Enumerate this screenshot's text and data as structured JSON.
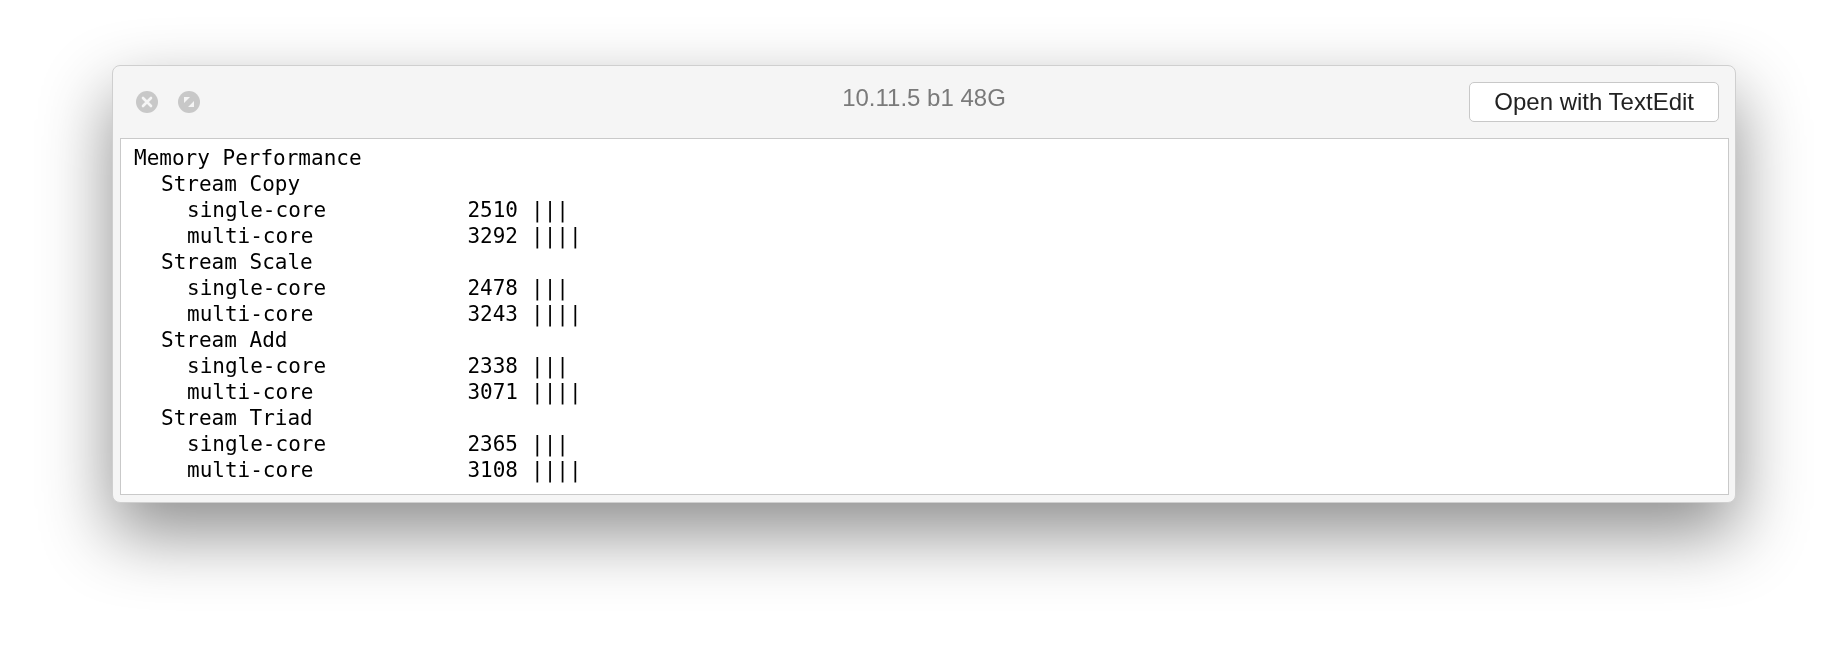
{
  "window": {
    "title": "10.11.5 b1 48G",
    "button": "Open with TextEdit"
  },
  "report": {
    "heading": "Memory Performance",
    "sections": [
      {
        "name": "Stream Copy",
        "rows": [
          {
            "label": "single-core",
            "value": "2510",
            "bars": "|||"
          },
          {
            "label": "multi-core",
            "value": "3292",
            "bars": "||||"
          }
        ]
      },
      {
        "name": "Stream Scale",
        "rows": [
          {
            "label": "single-core",
            "value": "2478",
            "bars": "|||"
          },
          {
            "label": "multi-core",
            "value": "3243",
            "bars": "||||"
          }
        ]
      },
      {
        "name": "Stream Add",
        "rows": [
          {
            "label": "single-core",
            "value": "2338",
            "bars": "|||"
          },
          {
            "label": "multi-core",
            "value": "3071",
            "bars": "||||"
          }
        ]
      },
      {
        "name": "Stream Triad",
        "rows": [
          {
            "label": "single-core",
            "value": "2365",
            "bars": "|||"
          },
          {
            "label": "multi-core",
            "value": "3108",
            "bars": "||||"
          }
        ]
      }
    ]
  }
}
